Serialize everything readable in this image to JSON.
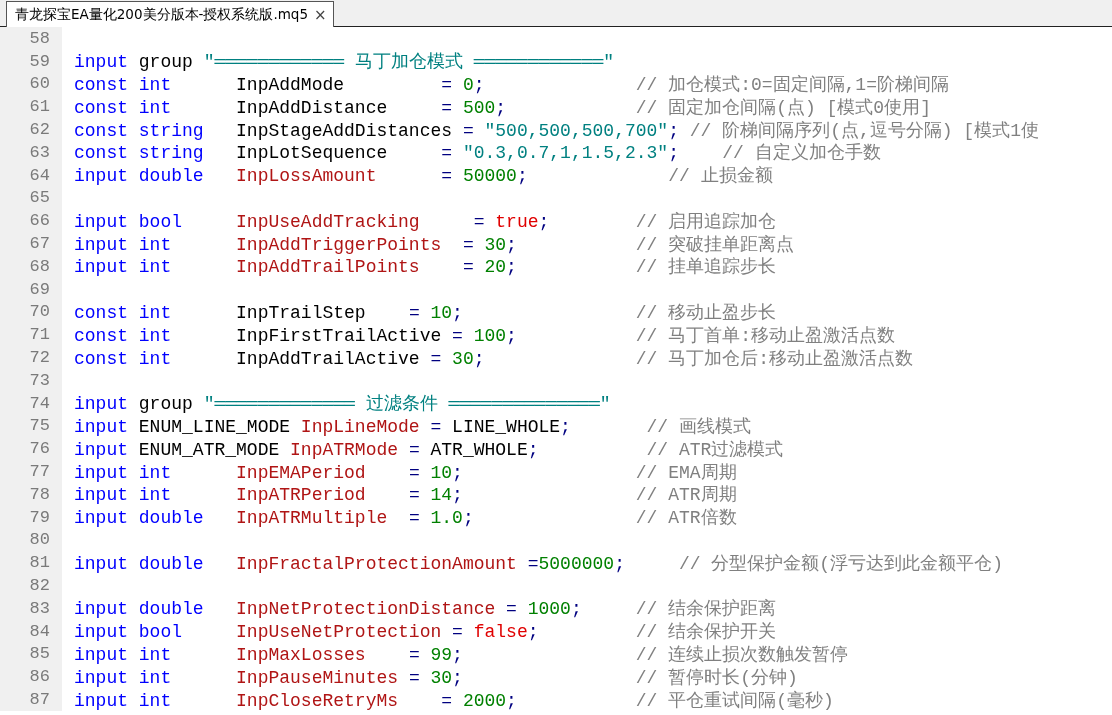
{
  "tabs": [
    {
      "title": "青龙探宝EA量化200美分版本-授权系统版.mq5",
      "close": "×"
    }
  ],
  "lines": [
    {
      "number": "58"
    },
    {
      "number": "59",
      "tokens": [
        {
          "kind": "kw",
          "text": "input"
        },
        {
          "kind": "plain",
          "text": " group"
        },
        {
          "kind": "str",
          "text": " \"════════════ 马丁加仓模式 ════════════\""
        }
      ]
    },
    {
      "number": "60",
      "tokens": [
        {
          "kind": "kw",
          "text": "const"
        },
        {
          "kind": "kw",
          "text": " int"
        },
        {
          "kind": "plain",
          "text": "      InpAddMode"
        },
        {
          "kind": "op",
          "text": "         ="
        },
        {
          "kind": "num",
          "text": " 0"
        },
        {
          "kind": "op",
          "text": ";"
        },
        {
          "kind": "cm",
          "text": "              // 加仓模式:0=固定间隔,1=阶梯间隔"
        }
      ]
    },
    {
      "number": "61",
      "tokens": [
        {
          "kind": "kw",
          "text": "const"
        },
        {
          "kind": "kw",
          "text": " int"
        },
        {
          "kind": "plain",
          "text": "      InpAddDistance"
        },
        {
          "kind": "op",
          "text": "     ="
        },
        {
          "kind": "num",
          "text": " 500"
        },
        {
          "kind": "op",
          "text": ";"
        },
        {
          "kind": "cm",
          "text": "            // 固定加仓间隔(点) [模式0使用]"
        }
      ]
    },
    {
      "number": "62",
      "tokens": [
        {
          "kind": "kw",
          "text": "const"
        },
        {
          "kind": "kw",
          "text": " string"
        },
        {
          "kind": "plain",
          "text": "   InpStageAddDistances"
        },
        {
          "kind": "op",
          "text": " ="
        },
        {
          "kind": "str",
          "text": " \"500,500,500,700\""
        },
        {
          "kind": "op",
          "text": ";"
        },
        {
          "kind": "cm",
          "text": " // 阶梯间隔序列(点,逗号分隔) [模式1使"
        }
      ]
    },
    {
      "number": "63",
      "tokens": [
        {
          "kind": "kw",
          "text": "const"
        },
        {
          "kind": "kw",
          "text": " string"
        },
        {
          "kind": "plain",
          "text": "   InpLotSequence"
        },
        {
          "kind": "op",
          "text": "     ="
        },
        {
          "kind": "str",
          "text": " \"0.3,0.7,1,1.5,2.3\""
        },
        {
          "kind": "op",
          "text": ";"
        },
        {
          "kind": "cm",
          "text": "    // 自定义加仓手数"
        }
      ]
    },
    {
      "number": "64",
      "tokens": [
        {
          "kind": "kw",
          "text": "input"
        },
        {
          "kind": "kw",
          "text": " double"
        },
        {
          "kind": "var",
          "text": "   InpLossAmount"
        },
        {
          "kind": "op",
          "text": "      ="
        },
        {
          "kind": "num",
          "text": " 50000"
        },
        {
          "kind": "op",
          "text": ";"
        },
        {
          "kind": "cm",
          "text": "             // 止损金额"
        }
      ]
    },
    {
      "number": "65"
    },
    {
      "number": "66",
      "tokens": [
        {
          "kind": "kw",
          "text": "input"
        },
        {
          "kind": "kw",
          "text": " bool"
        },
        {
          "kind": "var",
          "text": "     InpUseAddTracking"
        },
        {
          "kind": "op",
          "text": "     ="
        },
        {
          "kind": "bool",
          "text": " true"
        },
        {
          "kind": "op",
          "text": ";"
        },
        {
          "kind": "cm",
          "text": "        // 启用追踪加仓"
        }
      ]
    },
    {
      "number": "67",
      "tokens": [
        {
          "kind": "kw",
          "text": "input"
        },
        {
          "kind": "kw",
          "text": " int"
        },
        {
          "kind": "var",
          "text": "      InpAddTriggerPoints"
        },
        {
          "kind": "op",
          "text": "  ="
        },
        {
          "kind": "num",
          "text": " 30"
        },
        {
          "kind": "op",
          "text": ";"
        },
        {
          "kind": "cm",
          "text": "           // 突破挂单距离点"
        }
      ]
    },
    {
      "number": "68",
      "tokens": [
        {
          "kind": "kw",
          "text": "input"
        },
        {
          "kind": "kw",
          "text": " int"
        },
        {
          "kind": "var",
          "text": "      InpAddTrailPoints"
        },
        {
          "kind": "op",
          "text": "    ="
        },
        {
          "kind": "num",
          "text": " 20"
        },
        {
          "kind": "op",
          "text": ";"
        },
        {
          "kind": "cm",
          "text": "           // 挂单追踪步长"
        }
      ]
    },
    {
      "number": "69"
    },
    {
      "number": "70",
      "tokens": [
        {
          "kind": "kw",
          "text": "const"
        },
        {
          "kind": "kw",
          "text": " int"
        },
        {
          "kind": "plain",
          "text": "      InpTrailStep"
        },
        {
          "kind": "op",
          "text": "    ="
        },
        {
          "kind": "num",
          "text": " 10"
        },
        {
          "kind": "op",
          "text": ";"
        },
        {
          "kind": "cm",
          "text": "                // 移动止盈步长"
        }
      ]
    },
    {
      "number": "71",
      "tokens": [
        {
          "kind": "kw",
          "text": "const"
        },
        {
          "kind": "kw",
          "text": " int"
        },
        {
          "kind": "plain",
          "text": "      InpFirstTrailActive"
        },
        {
          "kind": "op",
          "text": " ="
        },
        {
          "kind": "num",
          "text": " 100"
        },
        {
          "kind": "op",
          "text": ";"
        },
        {
          "kind": "cm",
          "text": "           // 马丁首单:移动止盈激活点数"
        }
      ]
    },
    {
      "number": "72",
      "tokens": [
        {
          "kind": "kw",
          "text": "const"
        },
        {
          "kind": "kw",
          "text": " int"
        },
        {
          "kind": "plain",
          "text": "      InpAddTrailActive"
        },
        {
          "kind": "op",
          "text": " ="
        },
        {
          "kind": "num",
          "text": " 30"
        },
        {
          "kind": "op",
          "text": ";"
        },
        {
          "kind": "cm",
          "text": "              // 马丁加仓后:移动止盈激活点数"
        }
      ]
    },
    {
      "number": "73"
    },
    {
      "number": "74",
      "tokens": [
        {
          "kind": "kw",
          "text": "input"
        },
        {
          "kind": "plain",
          "text": " group"
        },
        {
          "kind": "str",
          "text": " \"═════════════ 过滤条件 ══════════════\""
        }
      ]
    },
    {
      "number": "75",
      "tokens": [
        {
          "kind": "kw",
          "text": "input"
        },
        {
          "kind": "plain",
          "text": " ENUM_LINE_MODE"
        },
        {
          "kind": "var",
          "text": " InpLineMode"
        },
        {
          "kind": "op",
          "text": " ="
        },
        {
          "kind": "plain",
          "text": " LINE_WHOLE"
        },
        {
          "kind": "op",
          "text": ";"
        },
        {
          "kind": "cm",
          "text": "       // 画线模式"
        }
      ]
    },
    {
      "number": "76",
      "tokens": [
        {
          "kind": "kw",
          "text": "input"
        },
        {
          "kind": "plain",
          "text": " ENUM_ATR_MODE"
        },
        {
          "kind": "var",
          "text": " InpATRMode"
        },
        {
          "kind": "op",
          "text": " ="
        },
        {
          "kind": "plain",
          "text": " ATR_WHOLE"
        },
        {
          "kind": "op",
          "text": ";"
        },
        {
          "kind": "cm",
          "text": "          // ATR过滤模式"
        }
      ]
    },
    {
      "number": "77",
      "tokens": [
        {
          "kind": "kw",
          "text": "input"
        },
        {
          "kind": "kw",
          "text": " int"
        },
        {
          "kind": "var",
          "text": "      InpEMAPeriod"
        },
        {
          "kind": "op",
          "text": "    ="
        },
        {
          "kind": "num",
          "text": " 10"
        },
        {
          "kind": "op",
          "text": ";"
        },
        {
          "kind": "cm",
          "text": "                // EMA周期"
        }
      ]
    },
    {
      "number": "78",
      "tokens": [
        {
          "kind": "kw",
          "text": "input"
        },
        {
          "kind": "kw",
          "text": " int"
        },
        {
          "kind": "var",
          "text": "      InpATRPeriod"
        },
        {
          "kind": "op",
          "text": "    ="
        },
        {
          "kind": "num",
          "text": " 14"
        },
        {
          "kind": "op",
          "text": ";"
        },
        {
          "kind": "cm",
          "text": "                // ATR周期"
        }
      ]
    },
    {
      "number": "79",
      "tokens": [
        {
          "kind": "kw",
          "text": "input"
        },
        {
          "kind": "kw",
          "text": " double"
        },
        {
          "kind": "var",
          "text": "   InpATRMultiple"
        },
        {
          "kind": "op",
          "text": "  ="
        },
        {
          "kind": "num",
          "text": " 1.0"
        },
        {
          "kind": "op",
          "text": ";"
        },
        {
          "kind": "cm",
          "text": "               // ATR倍数"
        }
      ]
    },
    {
      "number": "80"
    },
    {
      "number": "81",
      "tokens": [
        {
          "kind": "kw",
          "text": "input"
        },
        {
          "kind": "kw",
          "text": " double"
        },
        {
          "kind": "var",
          "text": "   InpFractalProtectionAmount"
        },
        {
          "kind": "op",
          "text": " ="
        },
        {
          "kind": "num",
          "text": "5000000"
        },
        {
          "kind": "op",
          "text": ";"
        },
        {
          "kind": "cm",
          "text": "     // 分型保护金额(浮亏达到此金额平仓)"
        }
      ]
    },
    {
      "number": "82"
    },
    {
      "number": "83",
      "tokens": [
        {
          "kind": "kw",
          "text": "input"
        },
        {
          "kind": "kw",
          "text": " double"
        },
        {
          "kind": "var",
          "text": "   InpNetProtectionDistance"
        },
        {
          "kind": "op",
          "text": " ="
        },
        {
          "kind": "num",
          "text": " 1000"
        },
        {
          "kind": "op",
          "text": ";"
        },
        {
          "kind": "cm",
          "text": "     // 结余保护距离"
        }
      ]
    },
    {
      "number": "84",
      "tokens": [
        {
          "kind": "kw",
          "text": "input"
        },
        {
          "kind": "kw",
          "text": " bool"
        },
        {
          "kind": "var",
          "text": "     InpUseNetProtection"
        },
        {
          "kind": "op",
          "text": " ="
        },
        {
          "kind": "bool",
          "text": " false"
        },
        {
          "kind": "op",
          "text": ";"
        },
        {
          "kind": "cm",
          "text": "         // 结余保护开关"
        }
      ]
    },
    {
      "number": "85",
      "tokens": [
        {
          "kind": "kw",
          "text": "input"
        },
        {
          "kind": "kw",
          "text": " int"
        },
        {
          "kind": "var",
          "text": "      InpMaxLosses"
        },
        {
          "kind": "op",
          "text": "    ="
        },
        {
          "kind": "num",
          "text": " 99"
        },
        {
          "kind": "op",
          "text": ";"
        },
        {
          "kind": "cm",
          "text": "                // 连续止损次数触发暂停"
        }
      ]
    },
    {
      "number": "86",
      "tokens": [
        {
          "kind": "kw",
          "text": "input"
        },
        {
          "kind": "kw",
          "text": " int"
        },
        {
          "kind": "var",
          "text": "      InpPauseMinutes"
        },
        {
          "kind": "op",
          "text": " ="
        },
        {
          "kind": "num",
          "text": " 30"
        },
        {
          "kind": "op",
          "text": ";"
        },
        {
          "kind": "cm",
          "text": "                // 暂停时长(分钟)"
        }
      ]
    },
    {
      "number": "87",
      "tokens": [
        {
          "kind": "kw",
          "text": "input"
        },
        {
          "kind": "kw",
          "text": " int"
        },
        {
          "kind": "var",
          "text": "      InpCloseRetryMs"
        },
        {
          "kind": "op",
          "text": "    ="
        },
        {
          "kind": "num",
          "text": " 2000"
        },
        {
          "kind": "op",
          "text": ";"
        },
        {
          "kind": "cm",
          "text": "           // 平仓重试间隔(毫秒)"
        }
      ]
    }
  ]
}
